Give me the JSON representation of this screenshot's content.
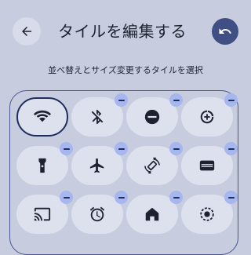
{
  "header": {
    "back_icon": "arrow-back-icon",
    "title": "タイルを編集する",
    "undo_icon": "undo-icon"
  },
  "instructions": "並べ替えとサイズ変更するタイルを選択",
  "tiles": [
    {
      "name": "wifi",
      "icon": "wifi-icon",
      "removable": false,
      "selected": true
    },
    {
      "name": "bluetooth-off",
      "icon": "bluetooth-disabled-icon",
      "removable": true
    },
    {
      "name": "do-not-disturb",
      "icon": "do-not-disturb-icon",
      "removable": true
    },
    {
      "name": "data-saver",
      "icon": "data-saver-icon",
      "removable": true
    },
    {
      "name": "flashlight",
      "icon": "flashlight-icon",
      "removable": true
    },
    {
      "name": "airplane-mode",
      "icon": "airplane-icon",
      "removable": true
    },
    {
      "name": "auto-rotate",
      "icon": "screen-rotation-icon",
      "removable": true
    },
    {
      "name": "wallet",
      "icon": "wallet-icon",
      "removable": true
    },
    {
      "name": "screen-cast",
      "icon": "cast-icon",
      "removable": true
    },
    {
      "name": "alarm",
      "icon": "alarm-icon",
      "removable": true
    },
    {
      "name": "home",
      "icon": "home-icon",
      "removable": true
    },
    {
      "name": "screen-record",
      "icon": "screen-record-icon",
      "removable": true
    }
  ]
}
